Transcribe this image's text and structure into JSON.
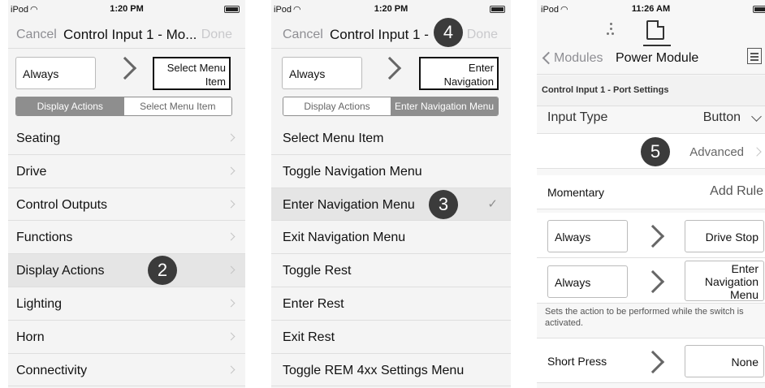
{
  "panel1": {
    "status": {
      "carrier": "iPod",
      "time": "1:20 PM"
    },
    "nav": {
      "cancel": "Cancel",
      "title": "Control Input 1 - Mo...",
      "done": "Done"
    },
    "rule": {
      "condition": "Always",
      "action": "Select Menu Item"
    },
    "segments": [
      "Display Actions",
      "Select Menu Item"
    ],
    "items": [
      {
        "label": "Seating"
      },
      {
        "label": "Drive"
      },
      {
        "label": "Control Outputs"
      },
      {
        "label": "Functions"
      },
      {
        "label": "Display Actions"
      },
      {
        "label": "Lighting"
      },
      {
        "label": "Horn"
      },
      {
        "label": "Connectivity"
      }
    ],
    "badge": "2"
  },
  "panel2": {
    "status": {
      "carrier": "iPod",
      "time": "1:20 PM"
    },
    "nav": {
      "cancel": "Cancel",
      "title": "Control Input 1 -",
      "done": "Done"
    },
    "rule": {
      "condition": "Always",
      "action": "Enter Navigation Menu"
    },
    "segments": [
      "Display Actions",
      "Enter Navigation Menu"
    ],
    "items": [
      {
        "label": "Select Menu Item"
      },
      {
        "label": "Toggle Navigation Menu"
      },
      {
        "label": "Enter Navigation Menu"
      },
      {
        "label": "Exit Navigation Menu"
      },
      {
        "label": "Toggle Rest"
      },
      {
        "label": "Enter Rest"
      },
      {
        "label": "Exit Rest"
      },
      {
        "label": "Toggle REM 4xx Settings Menu"
      }
    ],
    "check": "✓",
    "badge_item": "3",
    "badge_title": "4"
  },
  "panel3": {
    "status": {
      "carrier": "iPod",
      "time": "11:26 AM"
    },
    "nav": {
      "back": "Modules",
      "title": "Power Module"
    },
    "section": "Control Input 1 - Port Settings",
    "input_type": {
      "label": "Input Type",
      "value": "Button"
    },
    "advanced": "Advanced",
    "badge": "5",
    "momentary": {
      "label": "Momentary",
      "add_rule": "Add Rule"
    },
    "rules": [
      {
        "condition": "Always",
        "action": "Drive Stop"
      },
      {
        "condition": "Always",
        "action": "Enter Navigation Menu"
      }
    ],
    "note": "Sets the action to be performed while the switch is activated.",
    "short_press": {
      "label": "Short Press",
      "action": "None"
    }
  },
  "colors": {
    "badge": "#3b3b3b",
    "segment_active": "#8e8e8e",
    "selected_row": "#e5e5e5"
  }
}
